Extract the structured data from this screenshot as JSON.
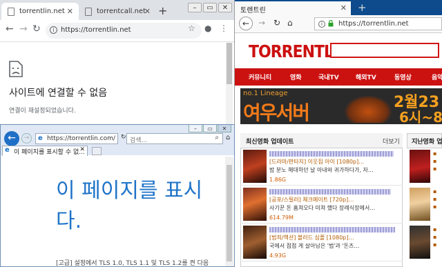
{
  "chrome": {
    "tabs": [
      {
        "label": "torrentlin.net",
        "active": true
      },
      {
        "label": "torrentcall.net",
        "active": false
      }
    ],
    "new_tab": "+",
    "url": "https://torrentlin.net",
    "error_title": "사이트에 연결할 수 없음",
    "error_sub": "연결이 재설정되었습니다."
  },
  "ie": {
    "url": "https://torrentlin.com/",
    "search_placeholder": "검색...",
    "tab_label": "이 페이지를 표시할 수 없...",
    "error_title": "이 페이지를 표시할 수 없습니다.",
    "error_title_line1": "이 페이지를 표시",
    "error_title_line2": "다.",
    "footer": "[고급] 설정에서 TLS 1.0, TLS 1.1 및 TLS 1.2를 켠 다음"
  },
  "firefox": {
    "tab_label": "토렌트린",
    "new_tab": "+",
    "url": "https://torrentlin.net",
    "logo": "TORRENTLiN",
    "menu": [
      "커뮤니티",
      "영화",
      "국내TV",
      "해외TV",
      "동영상",
      "음악"
    ],
    "banner": {
      "line1": "no.1 Lineage",
      "server": "여우서버",
      "date1": "2월23",
      "date2": "6시~8"
    },
    "panel_title": "최신영화 업데이트",
    "panel_more": "더보기",
    "panel2_title": "지난영화 업데이",
    "movies": [
      {
        "line1": "[드라마/판타지] 이웃집 아이 [1080p]…",
        "line2": "밤 분노 해대하던 날 아내와 귀가하다가, 자…",
        "size": "1.86G"
      },
      {
        "line1": "[공포/스릴러] 체크메이트 [720p]…",
        "line2": "사기꾼 돈 훔쳐오다 미쳐 했다 장례식장에서…",
        "size": "614.79M"
      },
      {
        "line1": "[범죄/액션] 블러드 심플 [1080p]…",
        "line2": "국에서 점점 게 살아남은 '범'과 '돈즈…",
        "size": "4.93G"
      }
    ]
  }
}
